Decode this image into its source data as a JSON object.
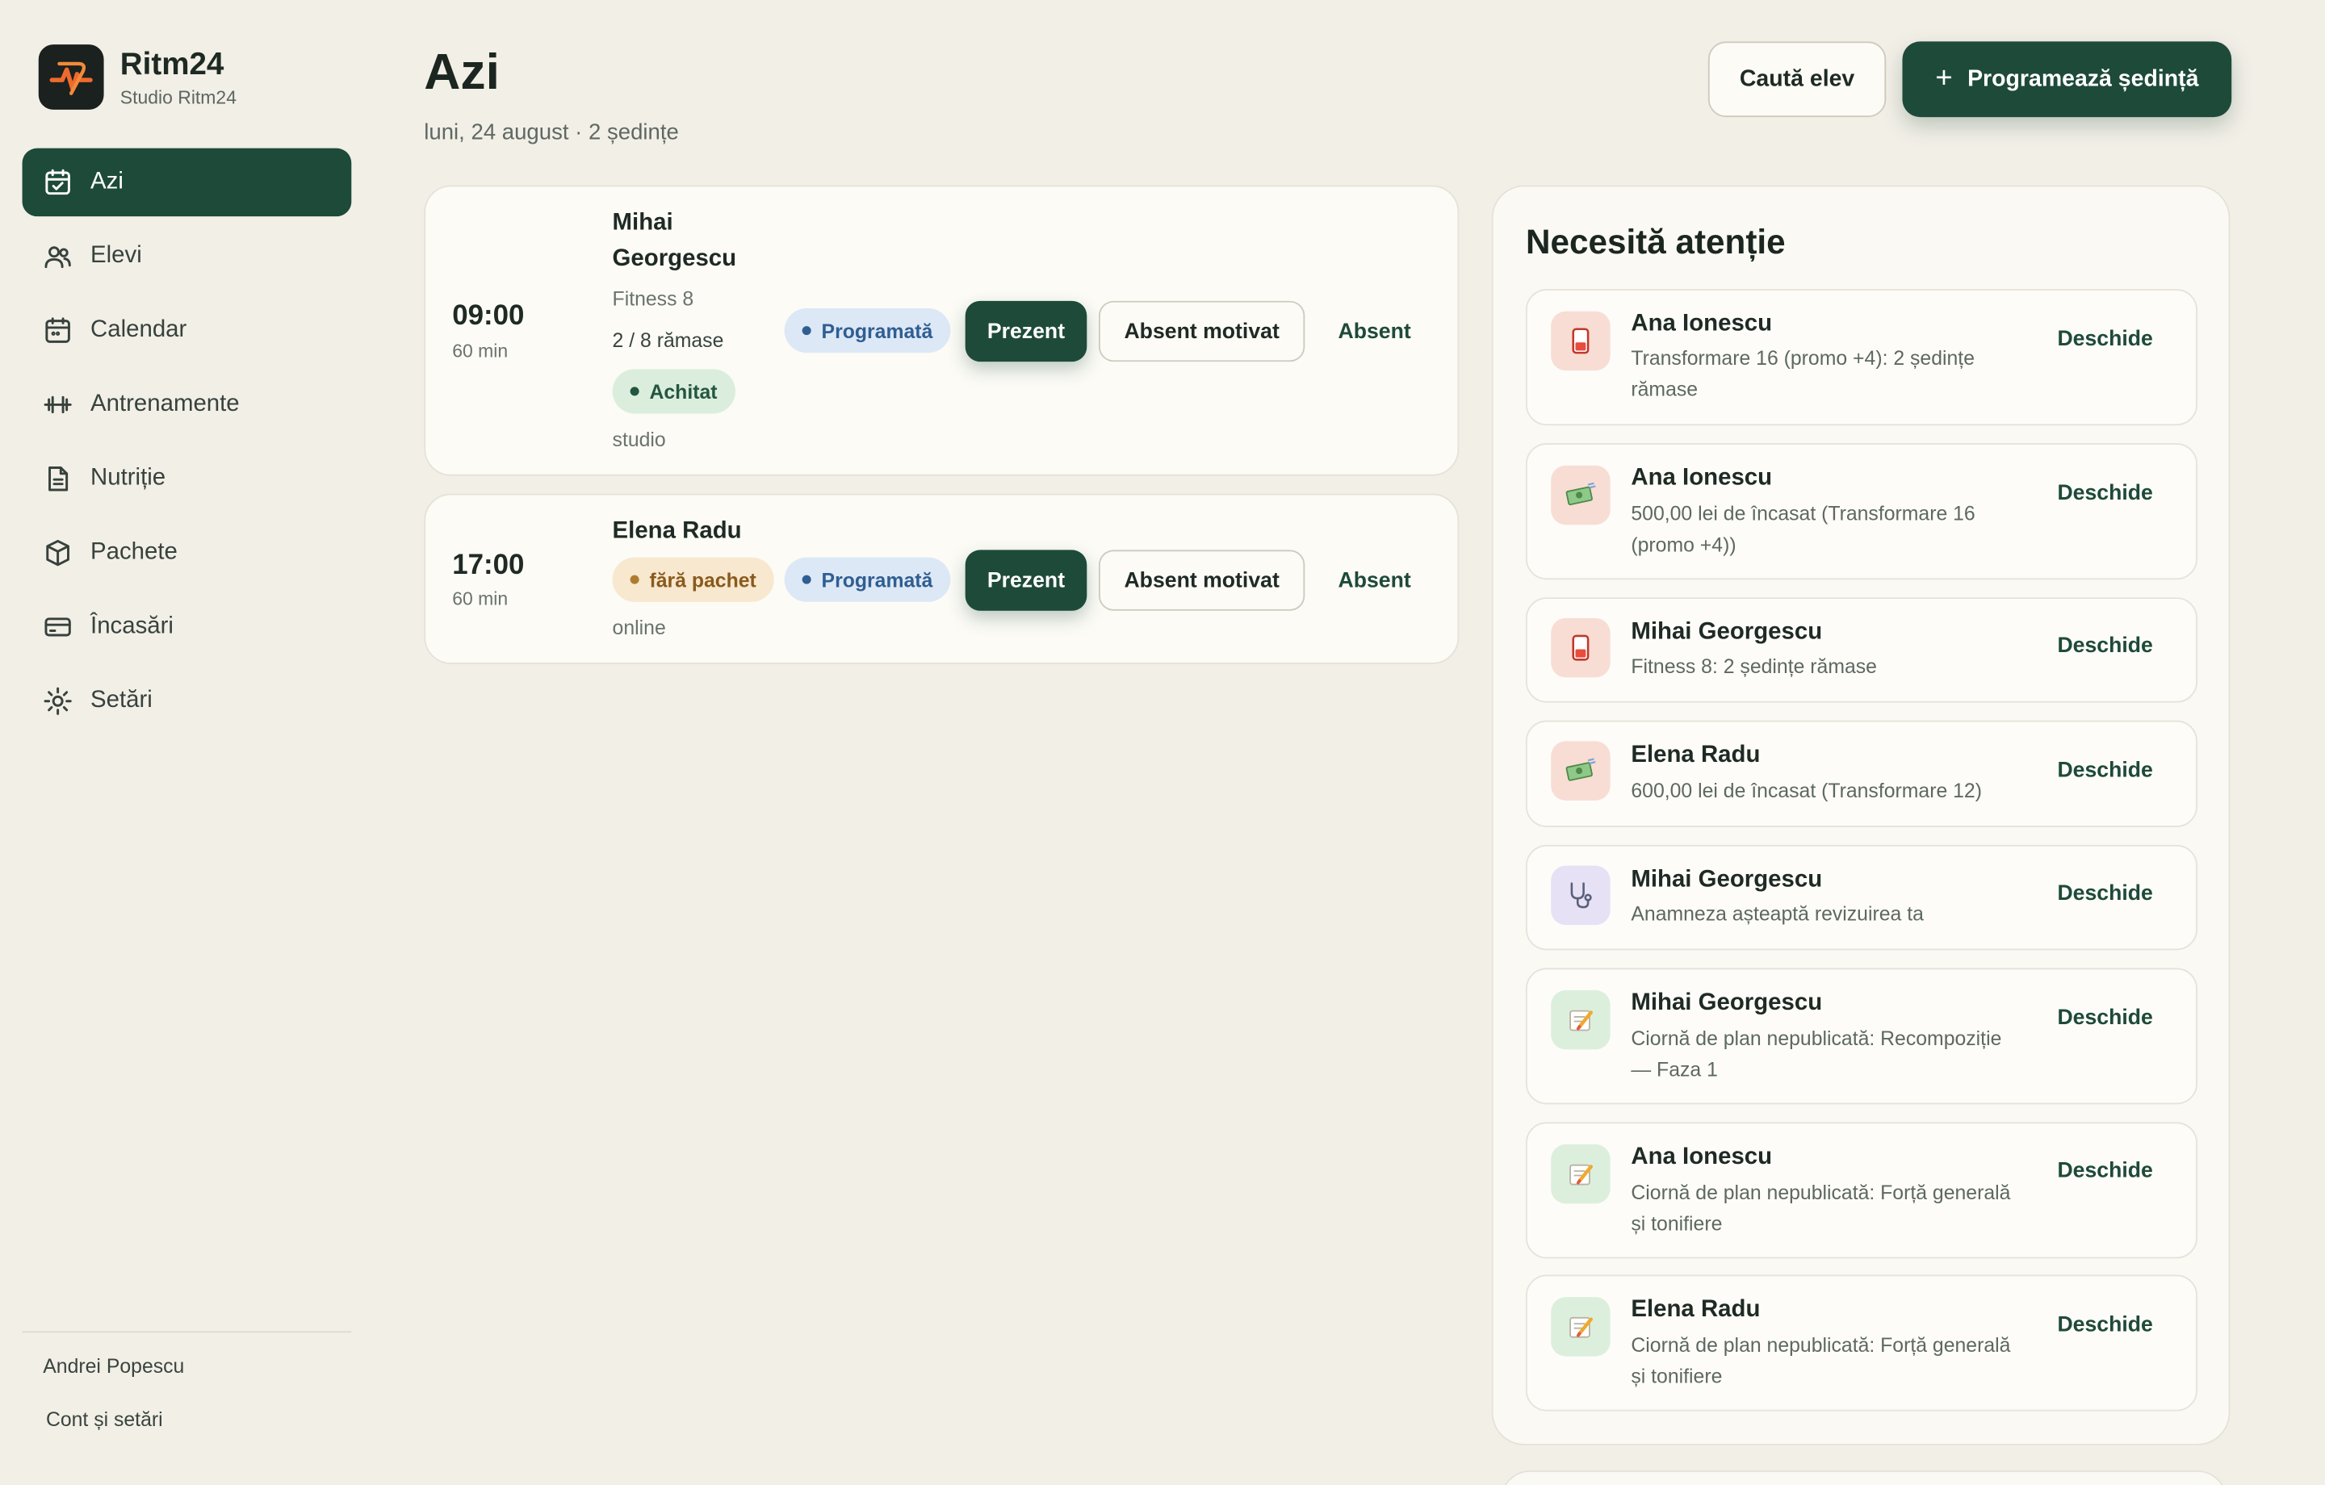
{
  "app": {
    "name": "Ritm24",
    "studio": "Studio Ritm24"
  },
  "nav": {
    "items": [
      {
        "label": "Azi",
        "icon": "calendar-check-icon"
      },
      {
        "label": "Elevi",
        "icon": "users-icon"
      },
      {
        "label": "Calendar",
        "icon": "calendar-icon"
      },
      {
        "label": "Antrenamente",
        "icon": "dumbbell-icon"
      },
      {
        "label": "Nutriție",
        "icon": "document-icon"
      },
      {
        "label": "Pachete",
        "icon": "package-icon"
      },
      {
        "label": "Încasări",
        "icon": "credit-card-icon"
      },
      {
        "label": "Setări",
        "icon": "gear-icon"
      }
    ],
    "active": "Azi"
  },
  "footer": {
    "user": "Andrei Popescu",
    "account": "Cont și setări"
  },
  "header": {
    "title": "Azi",
    "subtitle": "luni, 24 august · 2 ședințe",
    "search_button": "Caută elev",
    "schedule_button": "Programează ședință"
  },
  "sessions": [
    {
      "time": "09:00",
      "duration": "60 min",
      "name": "Mihai Georgescu",
      "package": "Fitness 8",
      "remaining": "2 / 8 rămase",
      "payment": "Achitat",
      "status": "Programată",
      "location": "studio",
      "actions": {
        "present": "Prezent",
        "excused": "Absent motivat",
        "absent": "Absent"
      }
    },
    {
      "time": "17:00",
      "duration": "60 min",
      "name": "Elena Radu",
      "package_badge": "fără pachet",
      "status": "Programată",
      "location": "online",
      "actions": {
        "present": "Prezent",
        "excused": "Absent motivat",
        "absent": "Absent"
      }
    }
  ],
  "attention": {
    "title": "Necesită atenție",
    "open_label": "Deschide",
    "items": [
      {
        "icon": "hourglass-icon",
        "name": "Ana Ionescu",
        "desc": "Transformare 16 (promo +4): 2 ședințe rămase"
      },
      {
        "icon": "money-icon",
        "name": "Ana Ionescu",
        "desc": "500,00 lei de încasat (Transformare 16 (promo +4))"
      },
      {
        "icon": "hourglass-icon",
        "name": "Mihai Georgescu",
        "desc": "Fitness 8: 2 ședințe rămase"
      },
      {
        "icon": "money-icon",
        "name": "Elena Radu",
        "desc": "600,00 lei de încasat (Transformare 12)"
      },
      {
        "icon": "stethoscope-icon",
        "name": "Mihai Georgescu",
        "desc": "Anamneza așteaptă revizuirea ta"
      },
      {
        "icon": "memo-icon",
        "name": "Mihai Georgescu",
        "desc": "Ciornă de plan nepublicată: Recompoziție — Faza 1"
      },
      {
        "icon": "memo-icon",
        "name": "Ana Ionescu",
        "desc": "Ciornă de plan nepublicată: Forță generală și tonifiere"
      },
      {
        "icon": "memo-icon",
        "name": "Elena Radu",
        "desc": "Ciornă de plan nepublicată: Forță generală și tonifiere"
      }
    ]
  },
  "colors": {
    "accent": "#1e4a3a",
    "background": "#f2efe7",
    "card": "#fcfbf6"
  }
}
